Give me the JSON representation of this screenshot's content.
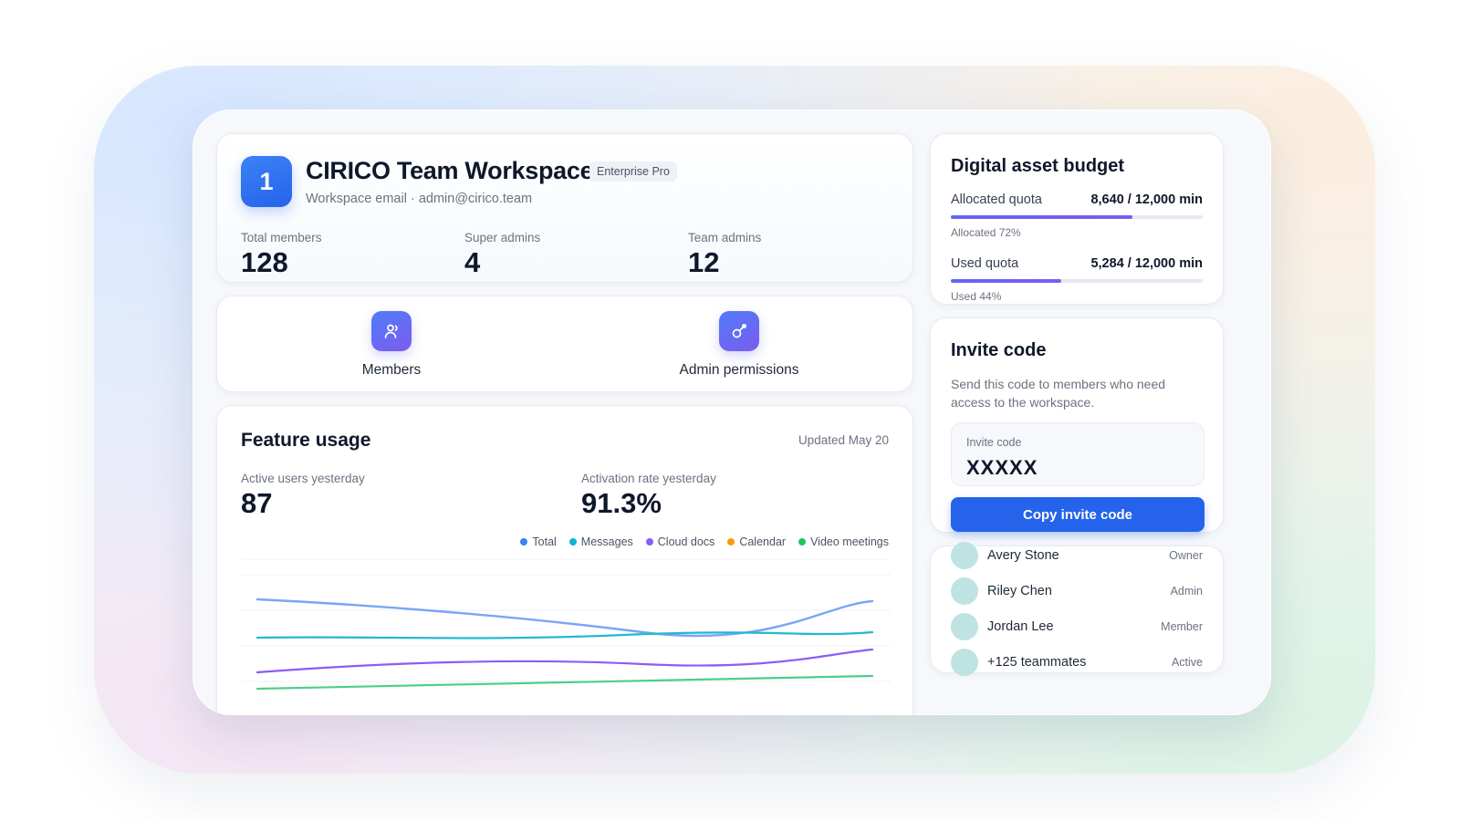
{
  "workspace": {
    "logo_text": "1",
    "name": "CIRICO Team Workspace",
    "plan_badge": "Enterprise Pro",
    "email_line": "Workspace email · admin@cirico.team",
    "stats": [
      {
        "label": "Total members",
        "value": "128"
      },
      {
        "label": "Super admins",
        "value": "4"
      },
      {
        "label": "Team admins",
        "value": "12"
      }
    ]
  },
  "quick_actions": [
    {
      "label": "Members",
      "icon": "members-icon"
    },
    {
      "label": "Admin permissions",
      "icon": "admin-key-icon"
    }
  ],
  "feature_usage": {
    "title": "Feature usage",
    "updated": "Updated May 20",
    "stats": [
      {
        "label": "Active users yesterday",
        "value": "87"
      },
      {
        "label": "Activation rate yesterday",
        "value": "91.3%"
      }
    ],
    "legend": [
      {
        "name": "Total",
        "color": "#3b82f6"
      },
      {
        "name": "Messages",
        "color": "#06b6d4"
      },
      {
        "name": "Cloud docs",
        "color": "#8b5cf6"
      },
      {
        "name": "Calendar",
        "color": "#f59e0b"
      },
      {
        "name": "Video meetings",
        "color": "#22c55e"
      }
    ]
  },
  "budget": {
    "title": "Digital asset budget",
    "allocated": {
      "label": "Allocated quota",
      "value": "8,640 / 12,000 min",
      "caption": "Allocated 72%",
      "fraction": 0.72
    },
    "used": {
      "label": "Used quota",
      "value": "5,284 / 12,000 min",
      "caption": "Used 44%",
      "fraction": 0.44
    }
  },
  "invite": {
    "title": "Invite code",
    "description": "Send this code to members who need access to the workspace.",
    "box_label": "Invite code",
    "code": "XXXXX",
    "button_label": "Copy invite code"
  },
  "members": [
    {
      "name": "Avery Stone",
      "role": "Owner"
    },
    {
      "name": "Riley Chen",
      "role": "Admin"
    },
    {
      "name": "Jordan Lee",
      "role": "Member"
    },
    {
      "name": "+125 teammates",
      "role": "Active"
    }
  ],
  "colors": {
    "accent": "#2563eb",
    "bar_fill": "#6366f1",
    "avatar": "#bfe3e2"
  }
}
